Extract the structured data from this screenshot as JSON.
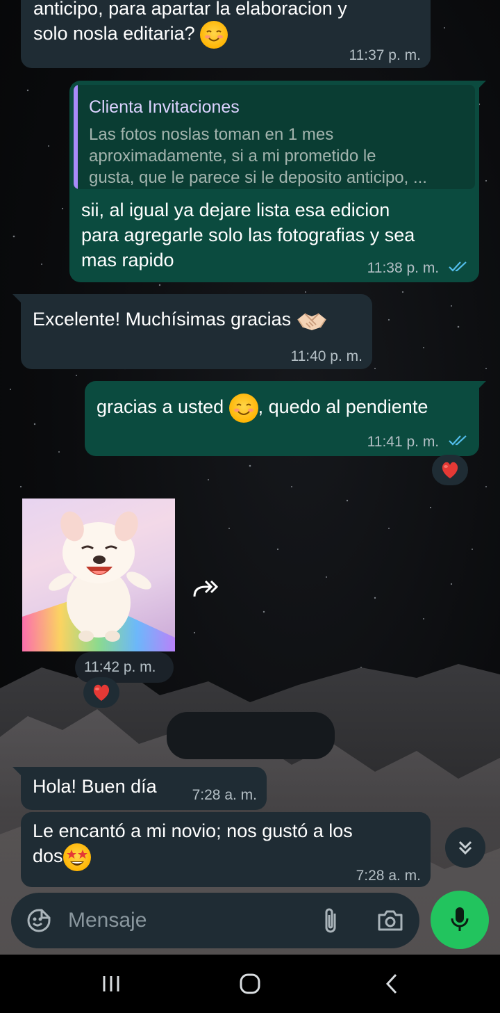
{
  "app": {
    "accent_color": "#22c45e",
    "incoming_bubble_color": "#1f2c34",
    "outgoing_bubble_color": "#0b4b3f",
    "read_tick_color": "#53bdeb"
  },
  "messages": [
    {
      "id": "m1",
      "direction": "incoming",
      "text_line1": "anticipo, para apartar la elaboracion y",
      "text_line2": "solo nosla editaria?",
      "emoji": "smiling-face-icon",
      "time": "11:37 p. m."
    },
    {
      "id": "m2",
      "direction": "outgoing",
      "quote_author": "Clienta Invitaciones",
      "quote_line1": "Las fotos noslas toman en 1 mes",
      "quote_line2": "aproximadamente, si a mi prometido le",
      "quote_line3": "gusta, que le parece si le deposito anticipo, ...",
      "text_line1": "sii, al igual ya dejare lista esa edicion",
      "text_line2": "para agregarle solo las fotografias y sea",
      "text_line3": "mas rapido",
      "time": "11:38 p. m.",
      "status": "read"
    },
    {
      "id": "m3",
      "direction": "incoming",
      "text": "Excelente! Muchísimas gracias",
      "emoji": "handshake-icon",
      "time": "11:40 p. m."
    },
    {
      "id": "m4",
      "direction": "outgoing",
      "text_before": "gracias a usted",
      "emoji": "smiling-face-icon",
      "text_after": ", quedo al pendiente",
      "time": "11:41 p. m.",
      "status": "read",
      "reaction": "red-heart-icon"
    },
    {
      "id": "m5",
      "direction": "incoming",
      "type": "sticker",
      "sticker": "happy-dog-sticker",
      "time": "11:42 p. m.",
      "reaction": "red-heart-icon"
    },
    {
      "id": "m6",
      "direction": "incoming",
      "text": "Hola! Buen día",
      "time": "7:28 a. m."
    },
    {
      "id": "m7",
      "direction": "incoming",
      "text_line1": "Le encantó a mi novio; nos gustó a los",
      "text_line2": "dos",
      "emoji": "star-struck-icon",
      "time": "7:28 a. m."
    }
  ],
  "composer": {
    "placeholder": "Mensaje",
    "icons": [
      "sticker-icon",
      "attach-icon",
      "camera-icon",
      "mic-icon"
    ]
  },
  "system_nav": {
    "icons": [
      "recents-icon",
      "home-icon",
      "back-icon"
    ]
  }
}
